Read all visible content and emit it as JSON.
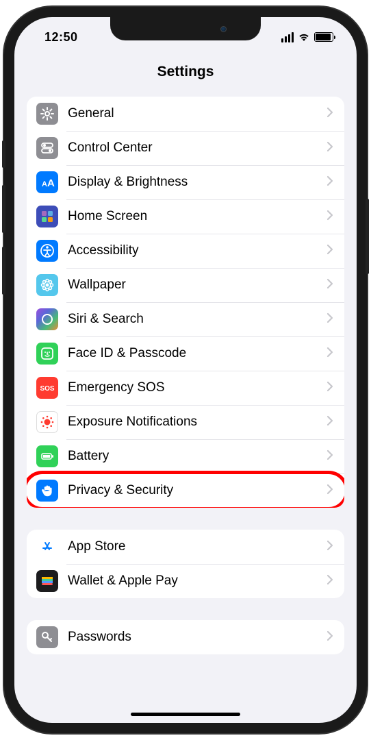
{
  "status": {
    "time": "12:50"
  },
  "header": {
    "title": "Settings"
  },
  "groups": [
    {
      "rows": [
        {
          "icon": "gear",
          "bg": "bg-gray",
          "label": "General"
        },
        {
          "icon": "toggles",
          "bg": "bg-gray",
          "label": "Control Center"
        },
        {
          "icon": "text-size",
          "bg": "bg-blue",
          "label": "Display & Brightness"
        },
        {
          "icon": "app-grid",
          "bg": "bg-homeblue",
          "label": "Home Screen"
        },
        {
          "icon": "figure",
          "bg": "bg-blue",
          "label": "Accessibility"
        },
        {
          "icon": "flower",
          "bg": "bg-cyan",
          "label": "Wallpaper"
        },
        {
          "icon": "siri",
          "bg": "bg-siri",
          "label": "Siri & Search"
        },
        {
          "icon": "face",
          "bg": "bg-green",
          "label": "Face ID & Passcode"
        },
        {
          "icon": "sos",
          "bg": "bg-red",
          "label": "Emergency SOS"
        },
        {
          "icon": "virus",
          "bg": "bg-white",
          "label": "Exposure Notifications"
        },
        {
          "icon": "battery",
          "bg": "bg-green",
          "label": "Battery"
        },
        {
          "icon": "hand",
          "bg": "bg-blue",
          "label": "Privacy & Security",
          "highlight": true
        }
      ]
    },
    {
      "rows": [
        {
          "icon": "appstore",
          "bg": "bg-blue",
          "label": "App Store"
        },
        {
          "icon": "wallet",
          "bg": "bg-black",
          "label": "Wallet & Apple Pay"
        }
      ]
    },
    {
      "rows": [
        {
          "icon": "key",
          "bg": "bg-gray",
          "label": "Passwords"
        }
      ]
    }
  ]
}
